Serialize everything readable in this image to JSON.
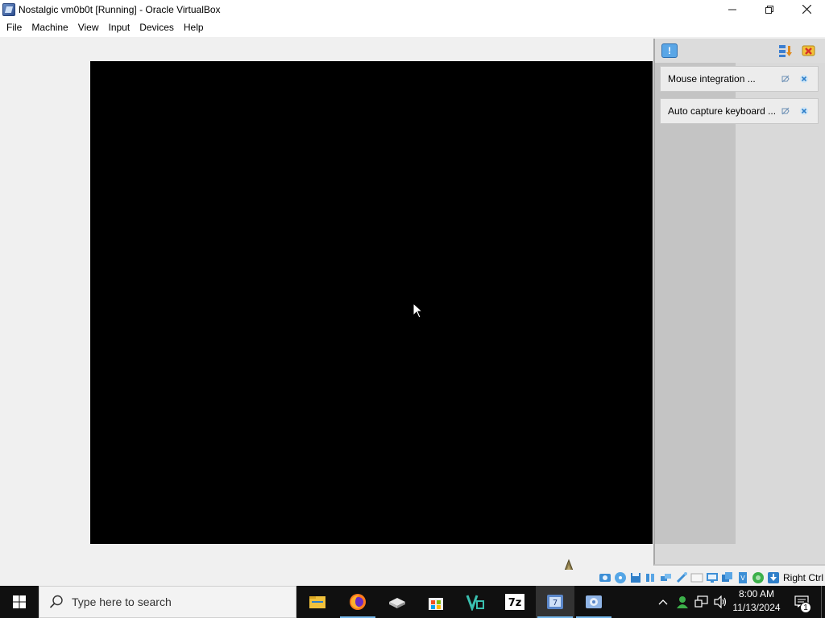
{
  "window": {
    "title": "Nostalgic vm0b0t [Running] - Oracle VirtualBox",
    "icon": "virtualbox-icon",
    "controls": [
      "minimize-icon",
      "maximize-icon",
      "close-icon"
    ]
  },
  "menubar": {
    "items": [
      "File",
      "Machine",
      "View",
      "Input",
      "Devices",
      "Help"
    ]
  },
  "notification_center": {
    "header_icons": [
      "notification-toggle-icon",
      "sort-icon",
      "clear-all-icon"
    ],
    "items": [
      {
        "label": "Mouse integration ...",
        "actions": [
          "pin-icon",
          "dismiss-icon"
        ]
      },
      {
        "label": "Auto capture keyboard ...",
        "actions": [
          "pin-icon",
          "dismiss-icon"
        ]
      }
    ]
  },
  "statusbar": {
    "icons": [
      "hard-disk-icon",
      "optical-drive-icon",
      "floppy-icon",
      "audio-icon",
      "network-icon",
      "usb-icon",
      "shared-folders-icon",
      "display-icon",
      "recording-icon",
      "cpu-icon",
      "mouse-integration-icon",
      "keyboard-icon"
    ],
    "host_key": "Right Ctrl"
  },
  "taskbar": {
    "search_placeholder": "Type here to search",
    "apps": [
      "file-explorer-icon",
      "firefox-icon",
      "book-app-icon",
      "microsoft-store-icon",
      "vs-app-icon",
      "7zip-icon",
      "virtualbox-taskbar-icon",
      "vm-app-icon"
    ],
    "clock_time": "8:00 AM",
    "clock_date": "11/13/2024",
    "notification_count": "1"
  },
  "colors": {
    "vm_screen": "#000000",
    "taskbar": "#101010",
    "accent": "#76b9ed"
  }
}
